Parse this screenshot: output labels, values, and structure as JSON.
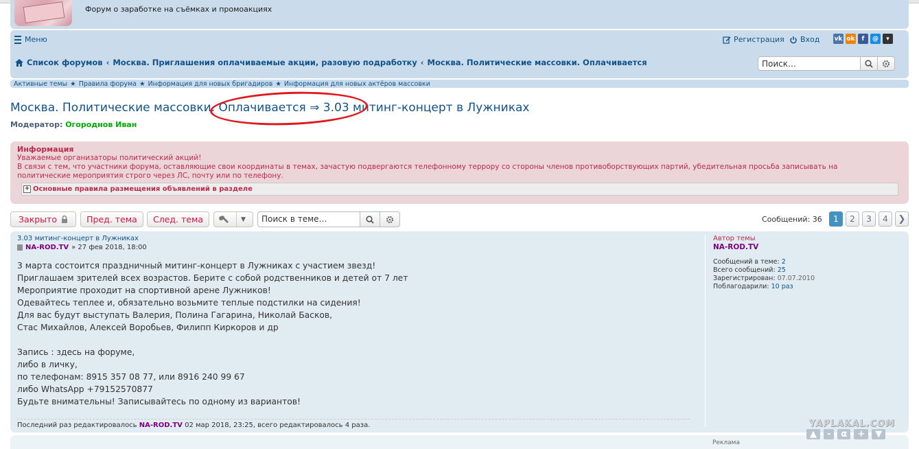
{
  "header": {
    "site_description": "Форум о заработке на съёмках и промоакциях"
  },
  "nav": {
    "menu_label": "Меню",
    "register_label": "Регистрация",
    "login_label": "Вход",
    "socials": [
      {
        "name": "vk",
        "glyph": "vk",
        "color": "#4a76a8"
      },
      {
        "name": "odnoklassniki",
        "glyph": "ok",
        "color": "#ee8208"
      },
      {
        "name": "facebook",
        "glyph": "f",
        "color": "#3b5998"
      },
      {
        "name": "mail",
        "glyph": "@",
        "color": "#168de2"
      },
      {
        "name": "more",
        "glyph": "▾",
        "color": "#333333"
      }
    ],
    "breadcrumbs": [
      "Список форумов",
      "Москва. Приглашения оплачиваемые акции, разовую подработку",
      "Москва. Политические массовки. Оплачивается"
    ],
    "search_placeholder": "Поиск…"
  },
  "quicklinks": [
    "Активные темы",
    "Правила форума",
    "Информация для новых бригадиров",
    "Информация для новых актёров массовки"
  ],
  "topic": {
    "title": "Москва. Политические массовки. Оплачивается ⇒ 3.03 митинг-концерт в Лужниках",
    "moderator_label": "Модератор:",
    "moderator_name": "Огороднов Иван"
  },
  "info": {
    "title": "Информация",
    "line1": "Уважаемые организаторы политический акций!",
    "line2": "В связи с тем, что участники форума, оставляющие свои координаты в темах, зачастую подвергаются телефонному террору со стороны членов противоборствующих партий, убедительная просьба записывать на",
    "line3": "политические мероприятия строго через ЛС, почту или по телефону.",
    "rules_label": "Основные правила размещения объявлений в разделе"
  },
  "actions": {
    "closed_label": "Закрыто",
    "prev_label": "Пред. тема",
    "next_label": "След. тема",
    "search_placeholder": "Поиск в теме…",
    "post_count": "Сообщений: 36",
    "pages": [
      "1",
      "2",
      "3",
      "4"
    ],
    "active_page": "1"
  },
  "post": {
    "subject": "3.03 митинг-концерт в Лужниках",
    "author": "NA-ROD.TV",
    "date": "» 27 фев 2018, 18:00",
    "lines": [
      "3 марта состоится праздничный митинг-концерт в Лужниках с участием звезд!",
      "Приглашаем зрителей всех возрастов. Берите с собой родственников и детей от 7 лет",
      "Мероприятие проходит на спортивной арене Лужников!",
      "Одевайтесь теплее и, обязательно возьмите теплые подстилки на сидения!",
      "Для вас будут выступать Валерия, Полина Гагарина, Николай Басков,",
      "Стас Михайлов, Алексей Воробьев, Филипп Киркоров и др",
      "",
      "Запись : здесь на форуме,",
      "либо в личку,",
      "по телефонам: 8915 357 08 77, или 8916 240 99 67",
      "либо WhatsApp +79152570877",
      "Будьте внимательны! Записывайтесь по одному из вариантов!"
    ],
    "edited_prefix": "Последний раз редактировалось",
    "edited_author": "NA-ROD.TV",
    "edited_suffix": "02 мар 2018, 23:25, всего редактировалось 4 раза."
  },
  "profile": {
    "author_label": "Автор темы",
    "username": "NA-ROD.TV",
    "topic_posts_label": "Сообщений в теме:",
    "topic_posts": "2",
    "total_posts_label": "Всего сообщений:",
    "total_posts": "25",
    "registered_label": "Зарегистрирован:",
    "registered": "07.07.2010",
    "thanks_label": "Поблагодарили:",
    "thanks": "10 раз"
  },
  "sidebar2": {
    "ad_label": "Реклама"
  },
  "watermark": {
    "text": "YAPLAKAL.COM",
    "buttons": [
      "▲",
      "-",
      "α",
      "+",
      "▼"
    ]
  }
}
